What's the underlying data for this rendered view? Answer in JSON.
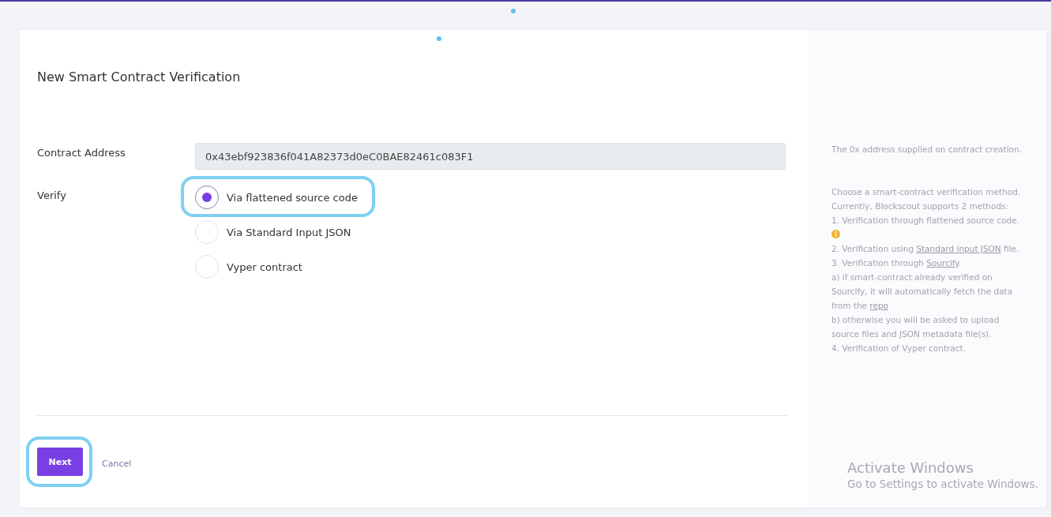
{
  "form": {
    "title": "New Smart Contract Verification",
    "address": {
      "label": "Contract Address",
      "value": "0x43ebf923836f041A82373d0eC0BAE82461c083F1"
    },
    "verify": {
      "label": "Verify",
      "options": [
        {
          "label": "Via flattened source code",
          "selected": true,
          "highlighted": true
        },
        {
          "label": "Via Standard Input JSON",
          "selected": false,
          "highlighted": false
        },
        {
          "label": "Vyper contract",
          "selected": false,
          "highlighted": false
        }
      ]
    },
    "buttons": [
      {
        "label": "Next",
        "kind": "primary",
        "highlighted": true
      },
      {
        "label": "Cancel",
        "kind": "link",
        "highlighted": false
      }
    ]
  },
  "help": [
    [
      [
        {
          "kind": "text",
          "text": "The 0x address supplied on contract creation."
        }
      ]
    ],
    [
      [
        {
          "kind": "text",
          "text": "Choose a smart-contract verification method. Currently, Blockscout supports 2 methods:"
        }
      ],
      [
        {
          "kind": "text",
          "text": "1. Verification through flattened source code. "
        },
        {
          "kind": "info"
        }
      ],
      [
        {
          "kind": "text",
          "text": "2. Verification using "
        },
        {
          "kind": "link",
          "text": "Standard input JSON"
        },
        {
          "kind": "text",
          "text": " file."
        }
      ],
      [
        {
          "kind": "text",
          "text": "3. Verification through "
        },
        {
          "kind": "link",
          "text": "Sourcify"
        },
        {
          "kind": "text",
          "text": "."
        }
      ],
      [
        {
          "kind": "text",
          "text": "a) if smart-contract already verified on Sourcify, it will automatically fetch the data from the "
        },
        {
          "kind": "link",
          "text": "repo"
        }
      ],
      [
        {
          "kind": "text",
          "text": "b) otherwise you will be asked to upload source files and JSON metadata file(s)."
        }
      ],
      [
        {
          "kind": "text",
          "text": "4. Verification of Vyper contract."
        }
      ]
    ]
  ],
  "os_notice": {
    "title": "Activate Windows",
    "subtitle": "Go to Settings to activate Windows."
  }
}
